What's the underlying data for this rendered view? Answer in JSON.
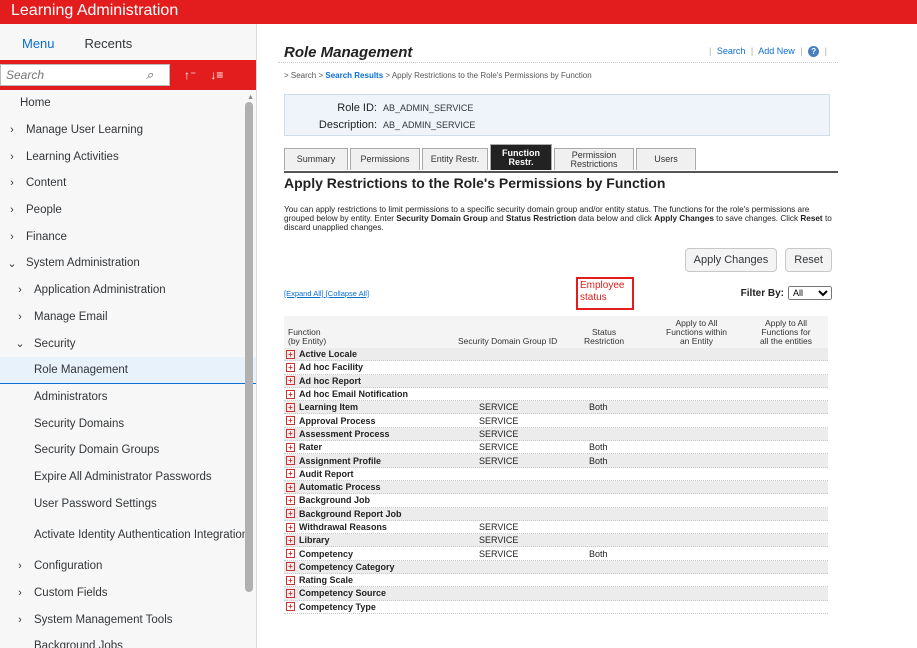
{
  "app": {
    "title": "Learning Administration"
  },
  "sidebar": {
    "tabs": [
      "Menu",
      "Recents"
    ],
    "search_placeholder": "Search",
    "items": [
      {
        "label": "Home",
        "level": 0,
        "chev": ""
      },
      {
        "label": "Manage User Learning",
        "level": 0,
        "chev": "›"
      },
      {
        "label": "Learning Activities",
        "level": 0,
        "chev": "›"
      },
      {
        "label": "Content",
        "level": 0,
        "chev": "›"
      },
      {
        "label": "People",
        "level": 0,
        "chev": "›"
      },
      {
        "label": "Finance",
        "level": 0,
        "chev": "›"
      },
      {
        "label": "System Administration",
        "level": 0,
        "chev": "⌄"
      },
      {
        "label": "Application Administration",
        "level": 1,
        "chev": "›"
      },
      {
        "label": "Manage Email",
        "level": 1,
        "chev": "›"
      },
      {
        "label": "Security",
        "level": 1,
        "chev": "⌄"
      },
      {
        "label": "Role Management",
        "level": 2,
        "chev": "",
        "selected": true
      },
      {
        "label": "Administrators",
        "level": 2,
        "chev": ""
      },
      {
        "label": "Security Domains",
        "level": 2,
        "chev": ""
      },
      {
        "label": "Security Domain Groups",
        "level": 2,
        "chev": ""
      },
      {
        "label": "Expire All Administrator Passwords",
        "level": 2,
        "chev": ""
      },
      {
        "label": "User Password Settings",
        "level": 2,
        "chev": ""
      },
      {
        "label": "Activate Identity Authentication Integration",
        "level": 2,
        "chev": "",
        "twoline": true
      },
      {
        "label": "Configuration",
        "level": 1,
        "chev": "›"
      },
      {
        "label": "Custom Fields",
        "level": 1,
        "chev": "›"
      },
      {
        "label": "System Management Tools",
        "level": 1,
        "chev": "›"
      },
      {
        "label": "Background Jobs",
        "level": 2,
        "chev": ""
      }
    ]
  },
  "main": {
    "page_title": "Role Management",
    "links": {
      "search": "Search",
      "add_new": "Add New"
    },
    "breadcrumb": {
      "prefix": "> Search > ",
      "link": "Search Results",
      "suffix": " > Apply Restrictions to the Role's Permissions by Function"
    },
    "role": {
      "id_label": "Role ID:",
      "id_value": "AB_ADMIN_SERVICE",
      "desc_label": "Description:",
      "desc_value": "AB_ ADMIN_SERVICE"
    },
    "tabs": [
      {
        "label": "Summary",
        "w": 64
      },
      {
        "label": "Permissions",
        "w": 70
      },
      {
        "label": "Entity Restr.",
        "w": 66
      },
      {
        "label": "Function Restr.",
        "w": 62,
        "active": true
      },
      {
        "label": "Permission Restrictions",
        "w": 80
      },
      {
        "label": "Users",
        "w": 60
      }
    ],
    "section_title": "Apply Restrictions to the Role's Permissions by Function",
    "description": {
      "p1": "You can apply restrictions to limit permissions to a specific security domain group and/or entity status. The functions for the role's permissions are grouped below by entity. Enter ",
      "b1": "Security Domain Group",
      "p2": " and ",
      "b2": "Status Restriction",
      "p3": " data below and click ",
      "b3": "Apply Changes",
      "p4": " to save changes. Click ",
      "b4": "Reset",
      "p5": " to discard unapplied changes."
    },
    "buttons": {
      "apply": "Apply Changes",
      "reset": "Reset"
    },
    "expand_all": "[Expand All]",
    "collapse_all": "[Collapse All]",
    "annotation": "Employee status",
    "filter_label": "Filter By:",
    "filter_value": "All",
    "columns": {
      "function": "Function\n(by Entity)",
      "sdg": "Security Domain Group ID",
      "status": "Status\nRestriction",
      "apply_entity": "Apply to All\nFunctions within\nan Entity",
      "apply_all": "Apply to All\nFunctions for\nall the entities"
    },
    "rows": [
      {
        "fn": "Active Locale",
        "sdg": "",
        "sr": ""
      },
      {
        "fn": "Ad hoc Facility",
        "sdg": "",
        "sr": ""
      },
      {
        "fn": "Ad hoc Report",
        "sdg": "",
        "sr": ""
      },
      {
        "fn": "Ad hoc Email Notification",
        "sdg": "",
        "sr": ""
      },
      {
        "fn": "Learning Item",
        "sdg": "SERVICE",
        "sr": "Both"
      },
      {
        "fn": "Approval Process",
        "sdg": "SERVICE",
        "sr": ""
      },
      {
        "fn": "Assessment Process",
        "sdg": "SERVICE",
        "sr": ""
      },
      {
        "fn": "Rater",
        "sdg": "SERVICE",
        "sr": "Both"
      },
      {
        "fn": "Assignment Profile",
        "sdg": "SERVICE",
        "sr": "Both"
      },
      {
        "fn": "Audit Report",
        "sdg": "",
        "sr": ""
      },
      {
        "fn": "Automatic Process",
        "sdg": "",
        "sr": ""
      },
      {
        "fn": "Background Job",
        "sdg": "",
        "sr": ""
      },
      {
        "fn": "Background Report Job",
        "sdg": "",
        "sr": ""
      },
      {
        "fn": "Withdrawal Reasons",
        "sdg": "SERVICE",
        "sr": ""
      },
      {
        "fn": "Library",
        "sdg": "SERVICE",
        "sr": ""
      },
      {
        "fn": "Competency",
        "sdg": "SERVICE",
        "sr": "Both"
      },
      {
        "fn": "Competency Category",
        "sdg": "",
        "sr": ""
      },
      {
        "fn": "Rating Scale",
        "sdg": "",
        "sr": ""
      },
      {
        "fn": "Competency Source",
        "sdg": "",
        "sr": ""
      },
      {
        "fn": "Competency Type",
        "sdg": "",
        "sr": ""
      }
    ]
  }
}
